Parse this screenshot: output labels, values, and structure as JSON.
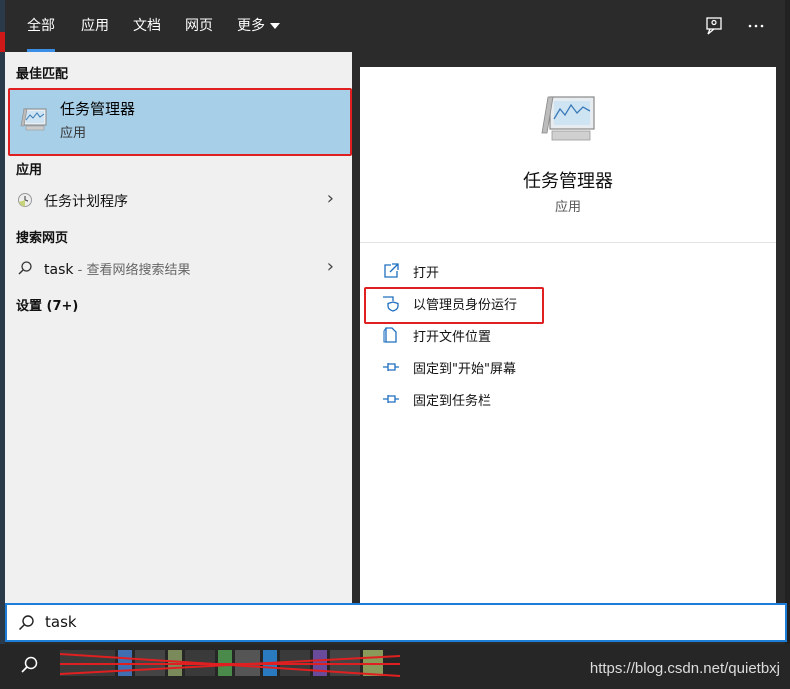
{
  "tabs": [
    {
      "label": "全部"
    },
    {
      "label": "应用"
    },
    {
      "label": "文档"
    },
    {
      "label": "网页"
    },
    {
      "label": "更多"
    }
  ],
  "left": {
    "best_match_heading": "最佳匹配",
    "best_match": {
      "title": "任务管理器",
      "subtitle": "应用"
    },
    "apps_heading": "应用",
    "apps": [
      {
        "label": "任务计划程序"
      }
    ],
    "web_heading": "搜索网页",
    "web": {
      "query": "task",
      "hint": " - 查看网络搜索结果"
    },
    "settings_heading": "设置 (7+)"
  },
  "right": {
    "title": "任务管理器",
    "subtitle": "应用",
    "actions": [
      {
        "label": "打开",
        "icon": "open-icon"
      },
      {
        "label": "以管理员身份运行",
        "icon": "shield-icon"
      },
      {
        "label": "打开文件位置",
        "icon": "file-location-icon"
      },
      {
        "label": "固定到\"开始\"屏幕",
        "icon": "pin-icon"
      },
      {
        "label": "固定到任务栏",
        "icon": "pin-icon"
      }
    ]
  },
  "search": {
    "value": "task"
  },
  "watermark": "https://blog.csdn.net/quietbxj",
  "colors": {
    "accent": "#3a8ee6",
    "highlight": "#a8cfe8",
    "annotation": "#e02020",
    "dark": "#2b2b2b"
  }
}
